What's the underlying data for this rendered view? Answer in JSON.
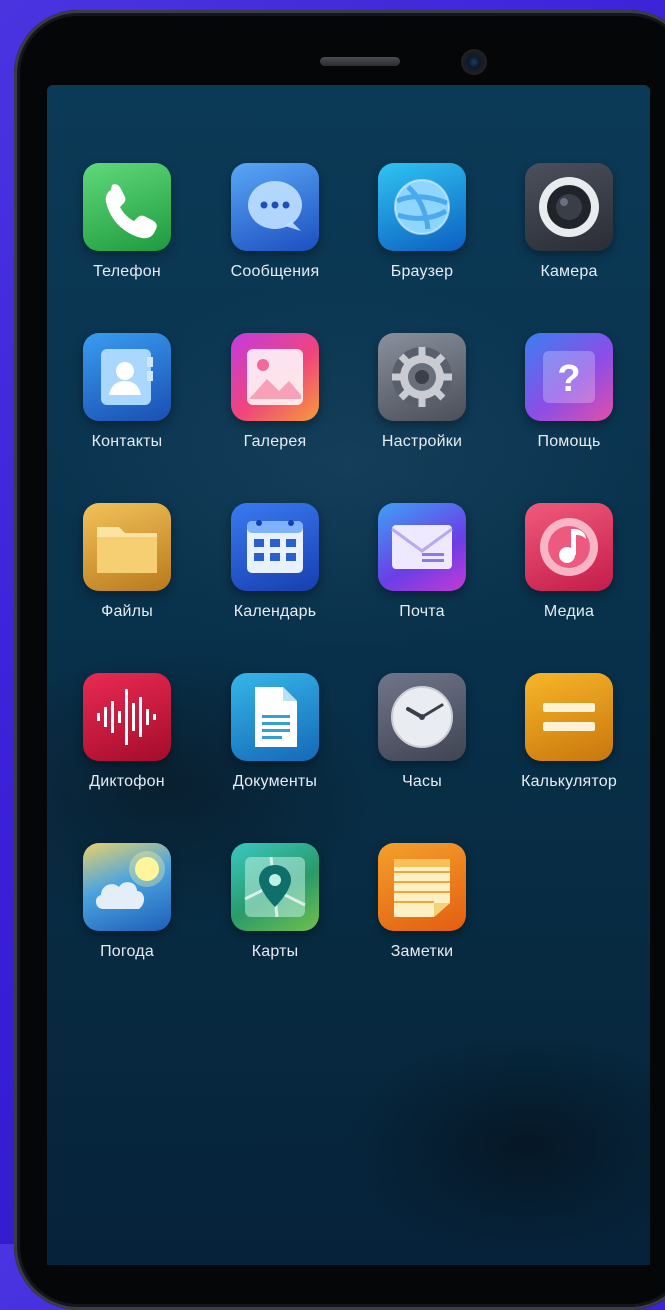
{
  "apps": [
    {
      "id": "phone",
      "label": "Телефон"
    },
    {
      "id": "messages",
      "label": "Сообщения"
    },
    {
      "id": "browser",
      "label": "Браузер"
    },
    {
      "id": "camera",
      "label": "Камера"
    },
    {
      "id": "contacts",
      "label": "Контакты"
    },
    {
      "id": "gallery",
      "label": "Галерея"
    },
    {
      "id": "settings",
      "label": "Настройки"
    },
    {
      "id": "help",
      "label": "Помощь"
    },
    {
      "id": "files",
      "label": "Файлы"
    },
    {
      "id": "calendar",
      "label": "Календарь"
    },
    {
      "id": "mail",
      "label": "Почта"
    },
    {
      "id": "media",
      "label": "Медиа"
    },
    {
      "id": "recorder",
      "label": "Диктофон"
    },
    {
      "id": "documents",
      "label": "Документы"
    },
    {
      "id": "clock",
      "label": "Часы"
    },
    {
      "id": "calculator",
      "label": "Калькулятор"
    },
    {
      "id": "weather",
      "label": "Погода"
    },
    {
      "id": "maps",
      "label": "Карты"
    },
    {
      "id": "notes",
      "label": "Заметки"
    }
  ],
  "icons": {
    "phone": "phone-icon",
    "messages": "chat-bubble-icon",
    "browser": "globe-icon",
    "camera": "camera-lens-icon",
    "contacts": "contact-card-icon",
    "gallery": "picture-icon",
    "settings": "gear-icon",
    "help": "question-icon",
    "files": "folder-icon",
    "calendar": "calendar-icon",
    "mail": "envelope-icon",
    "media": "music-note-icon",
    "recorder": "waveform-icon",
    "documents": "document-icon",
    "clock": "clock-icon",
    "calculator": "equals-icon",
    "weather": "sun-cloud-icon",
    "maps": "map-pin-icon",
    "notes": "notepad-icon"
  },
  "colors": {
    "phone": "#2fb24d",
    "messages": "#2b6fd8",
    "browser": "#1fa9e3",
    "camera": "#3b3f4a",
    "contacts": "#2b7fd4",
    "gallery": "#ee4a8a",
    "settings": "#6e7380",
    "help": "#7a5cf0",
    "files": "#d9a43a",
    "calendar": "#1e5fd0",
    "mail": "#5b3ee0",
    "media": "#e23a6a",
    "recorder": "#c8123a",
    "documents": "#1c8fd0",
    "clock": "#5c6270",
    "calculator": "#e4a21c",
    "weather": "#4aa3e0",
    "maps": "#27a39a",
    "notes": "#f2931a"
  }
}
